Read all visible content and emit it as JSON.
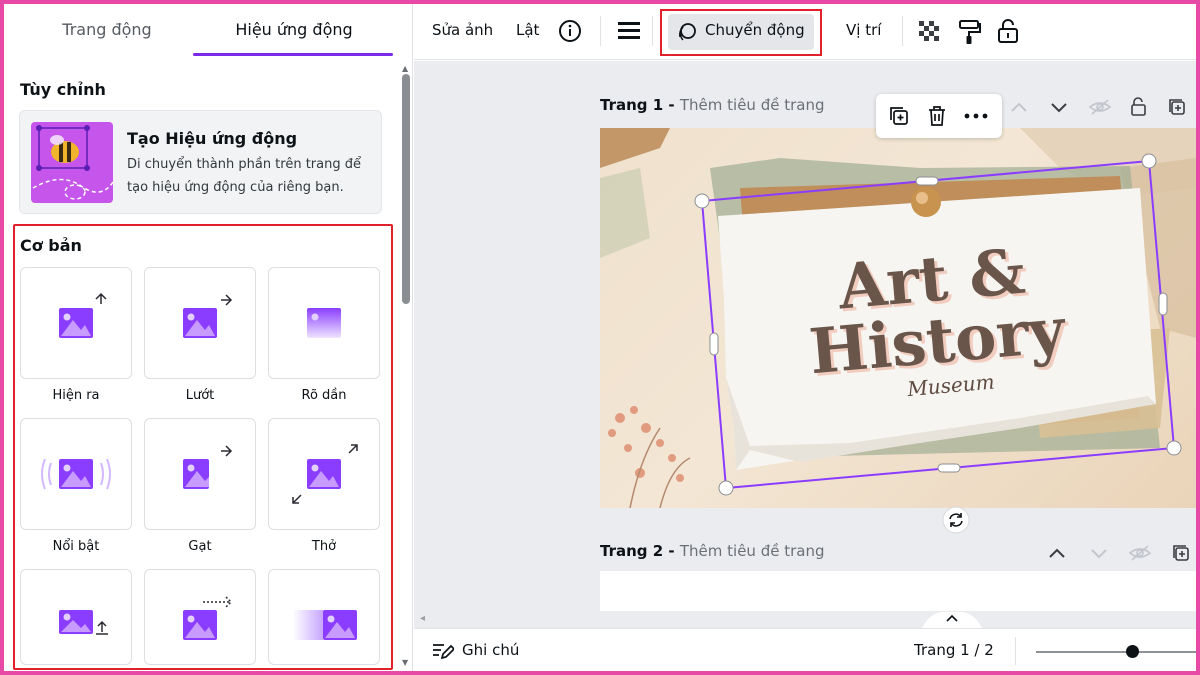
{
  "panel_tabs": [
    "Trang động",
    "Hiệu ứng động"
  ],
  "custom_section": {
    "title": "Tùy chỉnh",
    "card_title": "Tạo Hiệu ứng động",
    "card_desc": "Di chuyển thành phần trên trang để tạo hiệu ứng động của riêng bạn."
  },
  "basic_section": {
    "title": "Cơ bản",
    "effects": [
      {
        "label": "Hiện ra",
        "icon": "rise-icon"
      },
      {
        "label": "Lướt",
        "icon": "pan-icon"
      },
      {
        "label": "Rõ dần",
        "icon": "fade-icon"
      },
      {
        "label": "Nổi bật",
        "icon": "pop-icon"
      },
      {
        "label": "Gạt",
        "icon": "wipe-icon"
      },
      {
        "label": "Thở",
        "icon": "breathe-icon"
      },
      {
        "label": "",
        "icon": "baseline-icon"
      },
      {
        "label": "",
        "icon": "drift-icon"
      },
      {
        "label": "",
        "icon": "tectonic-icon"
      }
    ]
  },
  "toolbar": {
    "edit_photo": "Sửa ảnh",
    "flip": "Lật",
    "motion": "Chuyển động",
    "position": "Vị trí"
  },
  "pages": [
    {
      "label": "Trang 1 -",
      "placeholder": "Thêm tiêu đề trang"
    },
    {
      "label": "Trang 2 -",
      "placeholder": "Thêm tiêu đề trang"
    }
  ],
  "slide": {
    "line1": "Art &",
    "line2": "History",
    "line3": "Museum"
  },
  "bottom": {
    "notes": "Ghi chú",
    "page_indicator": "Trang 1 / 2",
    "zoom_fraction": 0.6
  },
  "colors": {
    "accent": "#7d2ae8",
    "highlight": "#e0202a",
    "border": "#e64aa6"
  }
}
